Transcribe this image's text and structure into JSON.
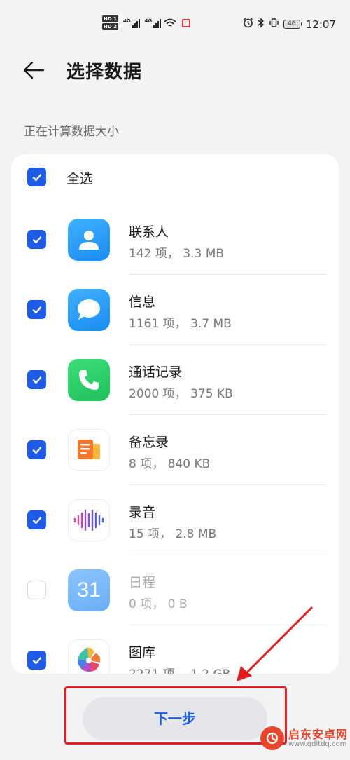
{
  "status_bar": {
    "hd_top": "HD 1",
    "hd_bottom": "HD 2",
    "sig1_label": "4G",
    "sig2_label": "4G",
    "battery": "46",
    "time": "12:07"
  },
  "header": {
    "title": "选择数据"
  },
  "subtitle": "正在计算数据大小",
  "select_all": {
    "label": "全选",
    "checked": true
  },
  "items": [
    {
      "title": "联系人",
      "meta": "142 项， 3.3 MB",
      "icon": "contacts-icon",
      "checked": true
    },
    {
      "title": "信息",
      "meta": "1161 项， 3.7 MB",
      "icon": "messages-icon",
      "checked": true
    },
    {
      "title": "通话记录",
      "meta": "2000 项， 375 KB",
      "icon": "phone-icon",
      "checked": true
    },
    {
      "title": "备忘录",
      "meta": "8 项， 840 KB",
      "icon": "notes-icon",
      "checked": true
    },
    {
      "title": "录音",
      "meta": "15 项， 2.8 MB",
      "icon": "recorder-icon",
      "checked": true
    },
    {
      "title": "日程",
      "meta": "0 项， 0 B",
      "icon": "calendar-icon",
      "icon_text": "31",
      "checked": false
    },
    {
      "title": "图库",
      "meta": "2271 项， 1.2 GB",
      "icon": "gallery-icon",
      "checked": true
    }
  ],
  "next_button": {
    "label": "下一步"
  },
  "watermark": {
    "title": "启东安卓网",
    "url": "www.qdltdq.com"
  },
  "colors": {
    "accent": "#1e5be6",
    "annotation": "#e02020"
  }
}
